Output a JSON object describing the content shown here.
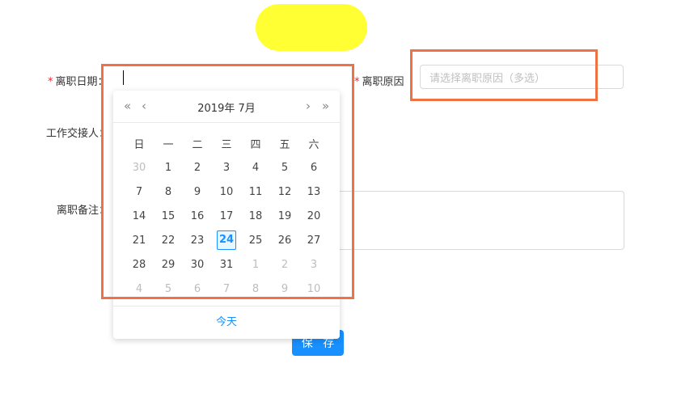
{
  "form": {
    "leave_date_label": "离职日期",
    "leave_reason_label": "离职原因",
    "reason_placeholder": "请选择离职原因（多选）",
    "handover_label": "工作交接人",
    "remark_label": "离职备注",
    "save_label": "保 存",
    "required_mark": "*"
  },
  "calendar": {
    "title": "2019年 7月",
    "prev_year": "«",
    "prev_month": "‹",
    "next_month": "›",
    "next_year": "»",
    "weekdays": [
      "日",
      "一",
      "二",
      "三",
      "四",
      "五",
      "六"
    ],
    "weeks": [
      [
        "30",
        "1",
        "2",
        "3",
        "4",
        "5",
        "6"
      ],
      [
        "7",
        "8",
        "9",
        "10",
        "11",
        "12",
        "13"
      ],
      [
        "14",
        "15",
        "16",
        "17",
        "18",
        "19",
        "20"
      ],
      [
        "21",
        "22",
        "23",
        "24",
        "25",
        "26",
        "27"
      ],
      [
        "28",
        "29",
        "30",
        "31",
        "1",
        "2",
        "3"
      ],
      [
        "4",
        "5",
        "6",
        "7",
        "8",
        "9",
        "10"
      ]
    ],
    "today_button": "今天"
  },
  "colors": {
    "accent": "#1890ff",
    "annotation": "#ee7244",
    "redaction": "#ffff33",
    "required": "#f5222d"
  }
}
